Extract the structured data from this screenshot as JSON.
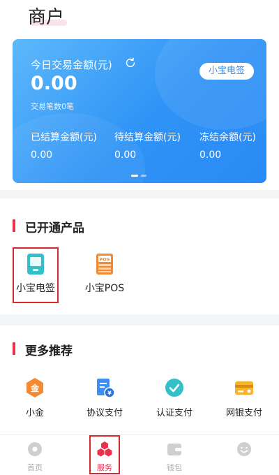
{
  "header": {
    "title": "商户"
  },
  "card": {
    "today_label": "今日交易金额(元)",
    "today_value": "0.00",
    "count_label": "交易笔数0笔",
    "sign_button": "小宝电签",
    "stats": [
      {
        "label": "已结算金额(元)",
        "value": "0.00"
      },
      {
        "label": "待结算金额(元)",
        "value": "0.00"
      },
      {
        "label": "冻结余额(元)",
        "value": "0.00"
      }
    ],
    "colors": {
      "gradient_start": "#5db8fb",
      "gradient_end": "#2a8af5"
    }
  },
  "products": {
    "title": "已开通产品",
    "items": [
      {
        "label": "小宝电签",
        "icon": "device-icon"
      },
      {
        "label": "小宝POS",
        "icon": "pos-icon"
      }
    ]
  },
  "recommend": {
    "title": "更多推荐",
    "items": [
      {
        "label": "小金",
        "icon": "gold-coin-icon"
      },
      {
        "label": "协议支付",
        "icon": "document-yuan-icon"
      },
      {
        "label": "认证支付",
        "icon": "check-circle-icon"
      },
      {
        "label": "网银支付",
        "icon": "bank-card-icon"
      }
    ]
  },
  "tabbar": {
    "items": [
      {
        "label": "首页",
        "icon": "home-icon"
      },
      {
        "label": "服务",
        "icon": "service-cubes-icon"
      },
      {
        "label": "钱包",
        "icon": "wallet-icon"
      },
      {
        "label": "",
        "icon": "smiley-icon"
      }
    ]
  },
  "accent": "#e8314d"
}
